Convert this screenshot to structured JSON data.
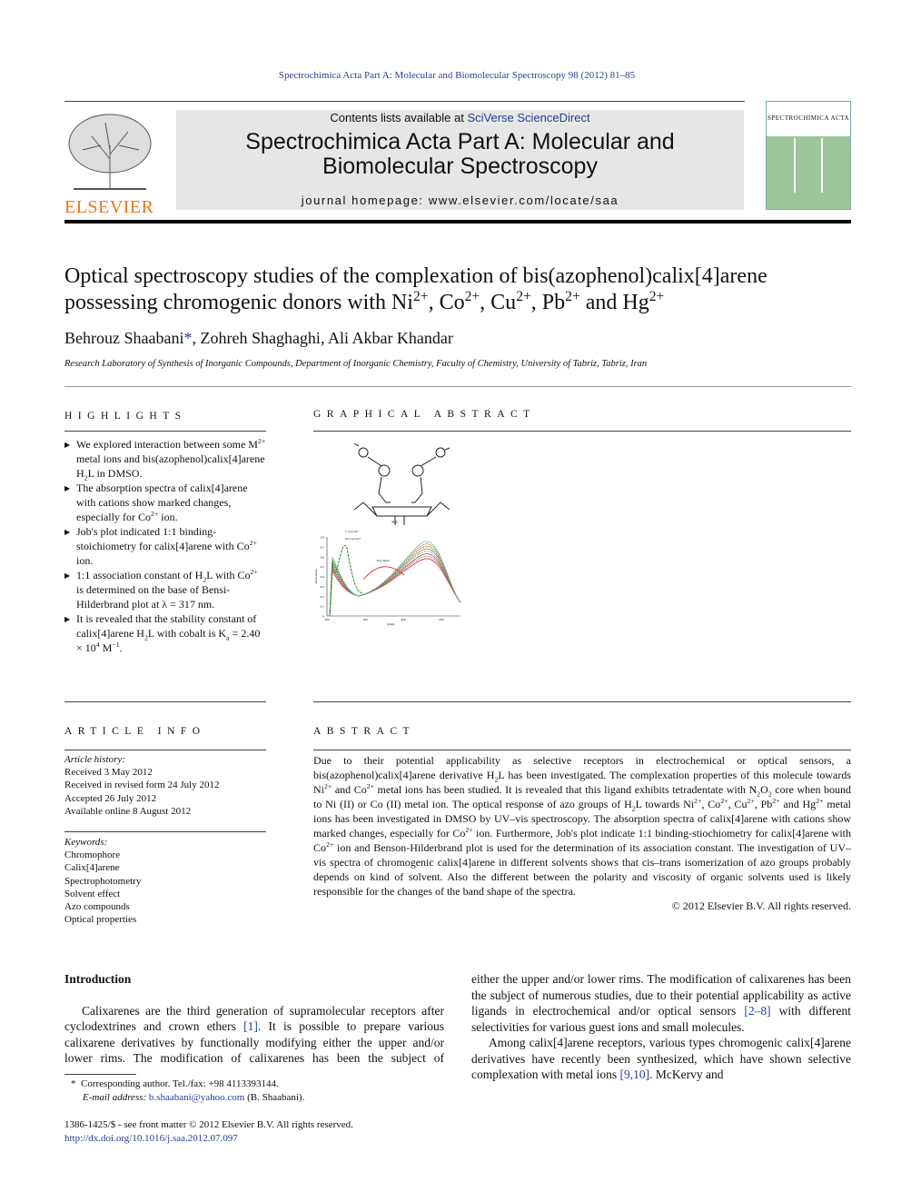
{
  "journal_ref": "Spectrochimica Acta Part A: Molecular and Biomolecular Spectroscopy 98 (2012) 81–85",
  "header": {
    "contents_prefix": "Contents lists available at ",
    "contents_link": "SciVerse ScienceDirect",
    "journal_title": "Spectrochimica Acta Part A: Molecular and Biomolecular Spectroscopy",
    "homepage": "journal homepage: www.elsevier.com/locate/saa",
    "publisher_logo": "ELSEVIER",
    "cover_title": "SPECTROCHIMICA ACTA"
  },
  "article": {
    "title": "Optical spectroscopy studies of the complexation of bis(azophenol)calix[4]arene possessing chromogenic donors with Ni^{2+}, Co^{2+}, Cu^{2+}, Pb^{2+} and Hg^{2+}",
    "authors": "Behrouz Shaabani",
    "author_mark": "*",
    "authors_rest": ", Zohreh Shaghaghi, Ali Akbar Khandar",
    "affiliation": "Research Laboratory of Synthesis of Inorganic Compounds, Department of Inorganic Chemistry, Faculty of Chemistry, University of Tabriz, Tabriz, Iran"
  },
  "highlights": {
    "heading": "HIGHLIGHTS",
    "items": [
      "We explored interaction between some M^{2+} metal ions and bis(azophenol)calix[4]arene H_{2}L in DMSO.",
      "The absorption spectra of calix[4]arene with cations show marked changes, especially for Co^{2+} ion.",
      "Job's plot indicated 1:1 binding-stoichiometry for calix[4]arene with Co^{2+} ion.",
      "1:1 association constant of H_{2}L with Co^{2+} is determined on the base of Bensi-Hilderbrand plot at λ = 317 nm.",
      "It is revealed that the stability constant of calix[4]arene H_{2}L with cobalt is K_{a} = 2.40 × 10^{4} M^{−1}."
    ]
  },
  "graphical_abstract": {
    "heading": "GRAPHICAL ABSTRACT",
    "molecule_label": "H2L",
    "chart": {
      "ylabel": "Absorbance",
      "xlabel": "λ(nm)",
      "yticks": [
        "0",
        "0.1",
        "0.2",
        "0.3",
        "0.4",
        "0.5",
        "0.6",
        "0.7",
        "0.8"
      ],
      "xticks": [
        "200",
        "300",
        "400",
        "500"
      ],
      "annotations": [
        "Free ligand",
        "1:1 eq Cu2+",
        "0:0.5 eq Cu2+"
      ]
    }
  },
  "article_info": {
    "heading": "ARTICLE INFO",
    "history_label": "Article history:",
    "history": [
      "Received 3 May 2012",
      "Received in revised form 24 July 2012",
      "Accepted 26 July 2012",
      "Available online 8 August 2012"
    ],
    "keywords_label": "Keywords:",
    "keywords": [
      "Chromophore",
      "Calix[4]arene",
      "Spectrophotometry",
      "Solvent effect",
      "Azo compounds",
      "Optical properties"
    ]
  },
  "abstract": {
    "heading": "ABSTRACT",
    "text": "Due to their potential applicability as selective receptors in electrochemical or optical sensors, a bis(azophenol)calix[4]arene derivative H_{2}L has been investigated. The complexation properties of this molecule towards Ni^{2+} and Co^{2+} metal ions has been studied. It is revealed that this ligand exhibits tetradentate with N_{2}O_{2} core when bound to Ni (II) or Co (II) metal ion. The optical response of azo groups of H_{2}L towards Ni^{2+}, Co^{2+}, Cu^{2+}, Pb^{2+} and Hg^{2+} metal ions has been investigated in DMSO by UV–vis spectroscopy. The absorption spectra of calix[4]arene with cations show marked changes, especially for Co^{2+} ion. Furthermore, Job's plot indicate 1:1 binding-stiochiometry for calix[4]arene with Co^{2+} ion and Benson-Hilderbrand plot is used for the determination of its association constant. The investigation of UV–vis spectra of chromogenic calix[4]arene in different solvents shows that cis–trans isomerization of azo groups probably depends on kind of solvent. Also the different between the polarity and viscosity of organic solvents used is likely responsible for the changes of the band shape of the spectra.",
    "copyright": "© 2012 Elsevier B.V. All rights reserved."
  },
  "intro": {
    "heading": "Introduction",
    "p1_a": "Calixarenes are the third generation of supramolecular receptors after cyclodextrines and crown ethers ",
    "p1_ref1": "[1]",
    "p1_b": ". It is possible to prepare various calixarene derivatives by functionally modifying either the upper and/or lower rims. The modification of calixarenes has been the subject of numerous studies, due to their potential applicability as active ligands in electrochemical and/or optical sensors ",
    "p1_ref2": "[2–8]",
    "p1_c": " with different selectivities for various guest ions and small molecules.",
    "p2_a": "Among calix[4]arene receptors, various types chromogenic calix[4]arene derivatives have recently been synthesized, which have shown selective complexation with metal ions ",
    "p2_ref": "[9,10]",
    "p2_b": ". McKervy and"
  },
  "footnote": {
    "mark": "*",
    "text": "Corresponding author. Tel./fax: +98 4113393144.",
    "email_label": "E-mail address:",
    "email": "b.shaabani@yahoo.com",
    "email_name": "(B. Shaabani)."
  },
  "footer": {
    "issn": "1386-1425/$ - see front matter © 2012 Elsevier B.V. All rights reserved.",
    "doi": "http://dx.doi.org/10.1016/j.saa.2012.07.097"
  }
}
